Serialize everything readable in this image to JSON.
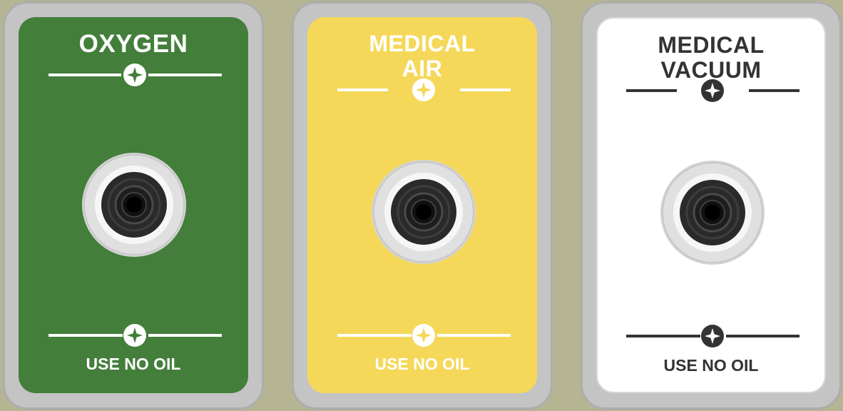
{
  "outlets": [
    {
      "gas": "oxygen",
      "title_lines": [
        "OXYGEN"
      ],
      "footer": "USE NO OIL",
      "plate_color": "#437e3b",
      "ink_color": "#ffffff",
      "icons": [
        "four-point-star-icon",
        "four-point-star-icon"
      ]
    },
    {
      "gas": "medical-air",
      "title_lines": [
        "MEDICAL",
        "AIR"
      ],
      "footer": "USE NO OIL",
      "plate_color": "#f5d85a",
      "ink_color": "#ffffff",
      "icons": [
        "four-point-star-icon",
        "four-point-star-icon"
      ]
    },
    {
      "gas": "medical-vacuum",
      "title_lines": [
        "MEDICAL",
        "VACUUM"
      ],
      "footer": "USE NO OIL",
      "plate_color": "#ffffff",
      "ink_color": "#333333",
      "icons": [
        "four-point-star-icon",
        "four-point-star-icon"
      ]
    }
  ],
  "bezel_color": "#c4c4c4",
  "background_color": "#b5b594"
}
